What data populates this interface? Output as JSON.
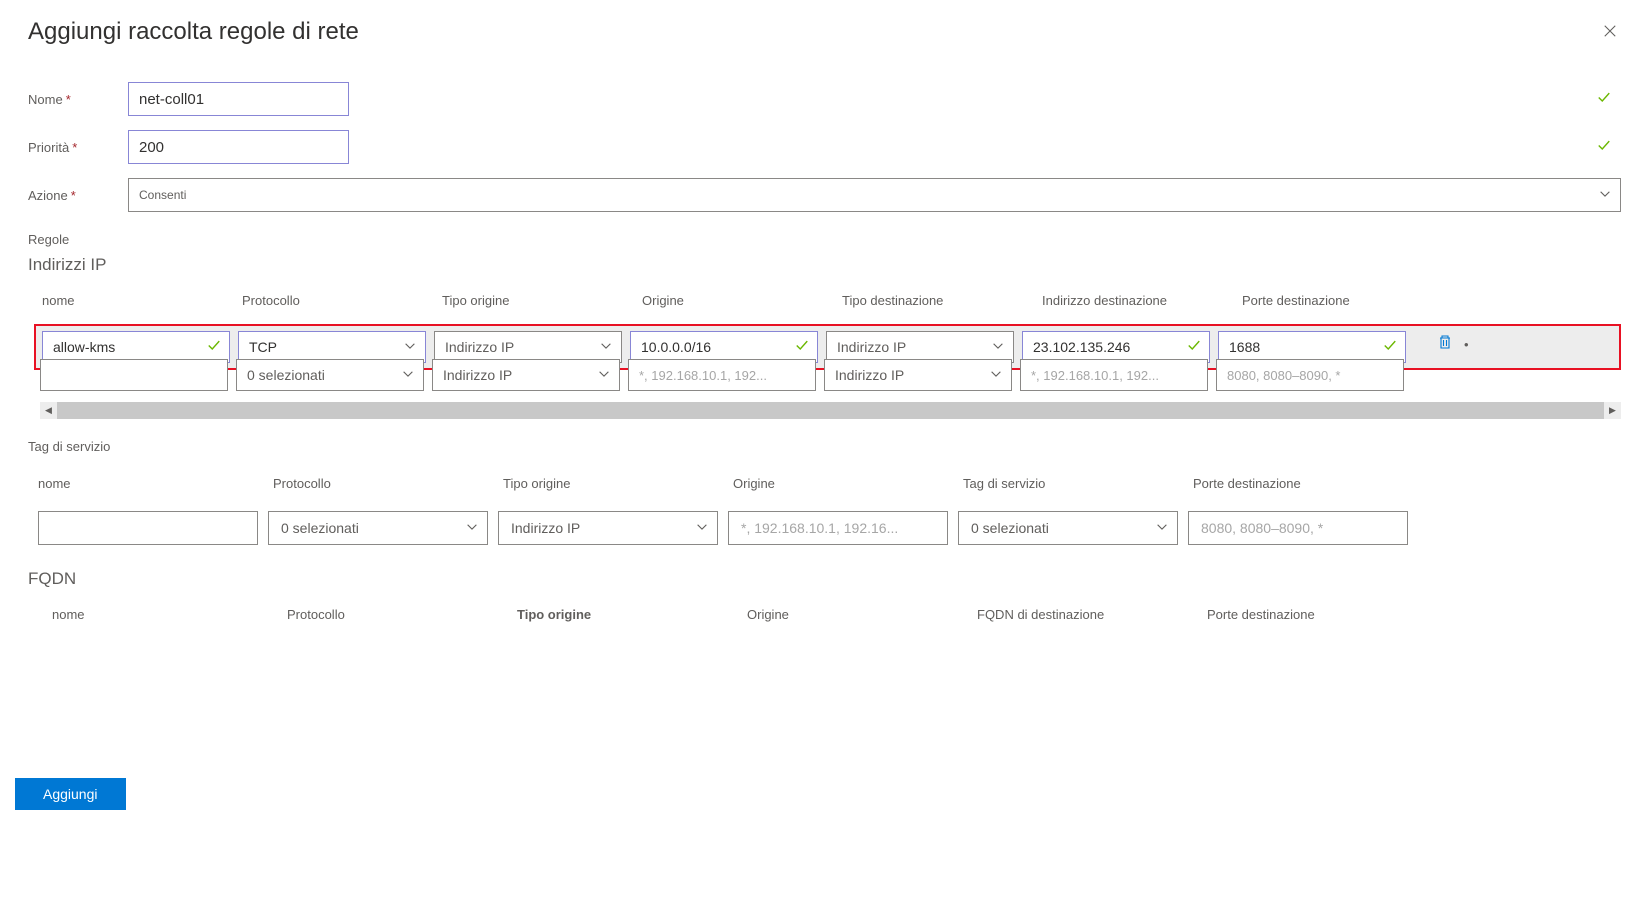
{
  "header": {
    "title": "Aggiungi raccolta regole di rete"
  },
  "form": {
    "name_label": "Nome",
    "name_value": "net-coll01",
    "priority_label": "Priorità",
    "priority_value": "200",
    "action_label": "Azione",
    "action_value": "Consenti"
  },
  "section_rules_label": "Regole",
  "ip_section": {
    "heading": "Indirizzi IP",
    "cols": {
      "name": "nome",
      "protocol": "Protocollo",
      "origin_type": "Tipo origine",
      "origin": "Origine",
      "dest_type": "Tipo destinazione",
      "dest_addr": "Indirizzo destinazione",
      "dest_ports": "Porte destinazione"
    },
    "row1": {
      "name": "allow-kms",
      "protocol": "TCP",
      "origin_type": "Indirizzo IP",
      "origin": "10.0.0.0/16",
      "dest_type": "Indirizzo IP",
      "dest_addr": "23.102.135.246",
      "dest_ports": "1688"
    },
    "row_placeholder": {
      "name": "",
      "protocol": "0 selezionati",
      "origin_type": "Indirizzo IP",
      "origin": "*, 192.168.10.1, 192...",
      "dest_type": "Indirizzo IP",
      "dest_addr": "*, 192.168.10.1, 192...",
      "dest_ports": "8080, 8080–8090, *"
    }
  },
  "svc_section": {
    "heading": "Tag di servizio",
    "cols": {
      "name": "nome",
      "protocol": "Protocollo",
      "origin_type": "Tipo origine",
      "origin": "Origine",
      "svc_tag": "Tag di servizio",
      "dest_ports": "Porte destinazione"
    },
    "row_placeholder": {
      "name": "",
      "protocol": "0 selezionati",
      "origin_type": "Indirizzo IP",
      "origin": "*, 192.168.10.1, 192.16...",
      "svc_tag": "0 selezionati",
      "dest_ports": "8080, 8080–8090, *"
    }
  },
  "fqdn_section": {
    "heading": "FQDN",
    "cols": {
      "name": "nome",
      "protocol": "Protocollo",
      "origin_type": "Tipo origine",
      "origin": "Origine",
      "fqdn_dest": "FQDN di destinazione",
      "dest_ports": "Porte destinazione"
    }
  },
  "footer": {
    "add_label": "Aggiungi"
  }
}
